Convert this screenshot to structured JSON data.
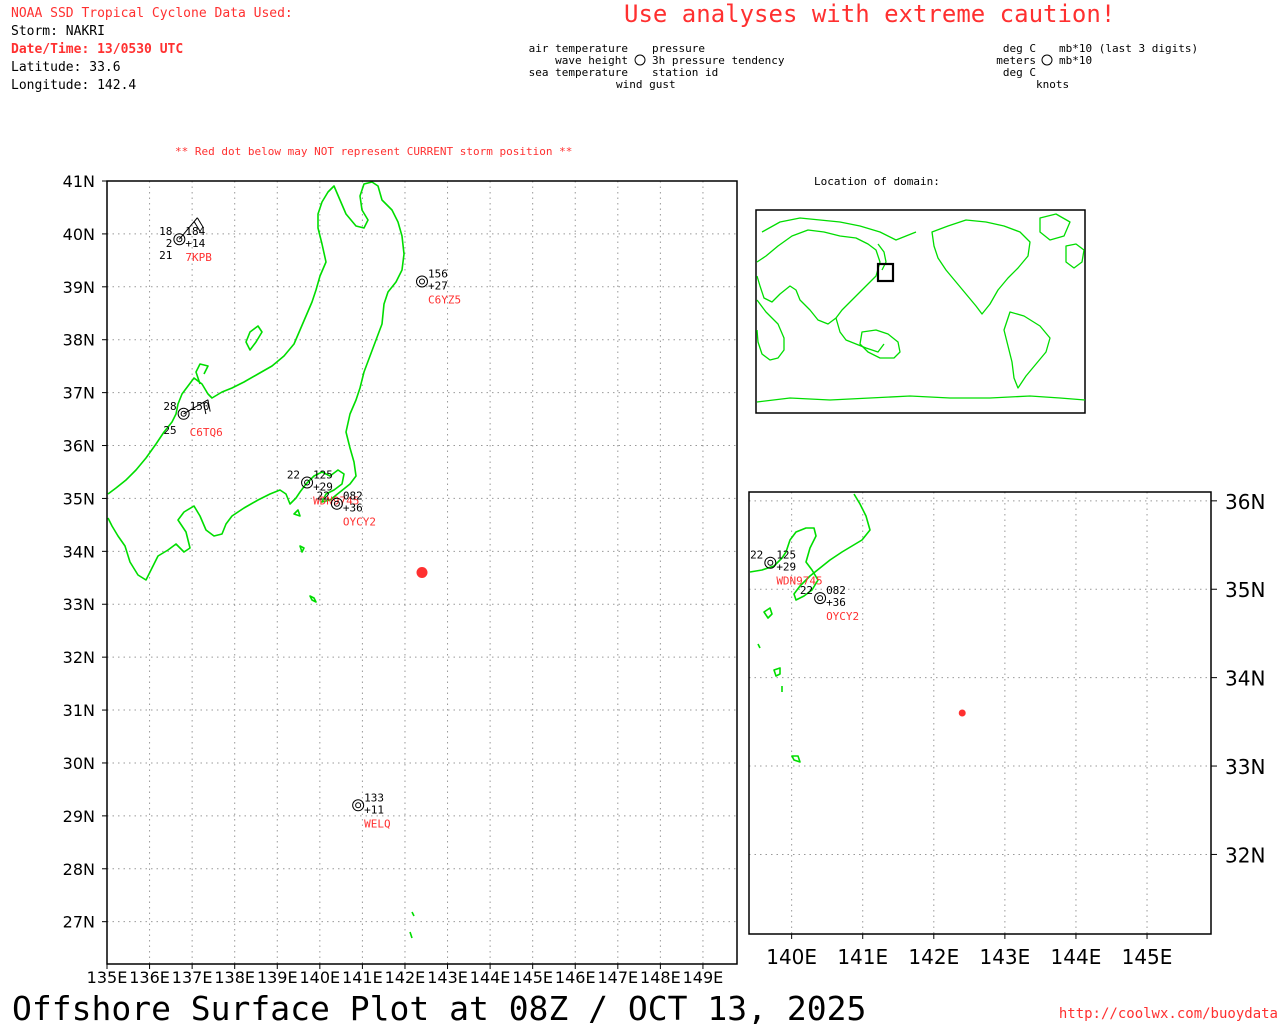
{
  "header": {
    "source_title": "NOAA SSD Tropical Cyclone Data Used:",
    "storm": "Storm: NAKRI",
    "datetime": "Date/Time: 13/0530 UTC",
    "latitude": "Latitude: 33.6",
    "longitude": "Longitude: 142.4",
    "caution": "Use analyses with extreme caution!",
    "red_dot_note": "** Red dot below may NOT represent CURRENT storm position **",
    "domain_title": "Location of domain:",
    "footer_title": "Offshore Surface Plot at 08Z / OCT 13, 2025",
    "footer_url": "http://coolwx.com/buoydata"
  },
  "legend": {
    "left": [
      "air temperature",
      "wave height",
      "sea temperature"
    ],
    "right": [
      "pressure",
      "3h pressure tendency",
      "station id"
    ],
    "bottom": "wind gust",
    "units_left": [
      "deg C",
      "meters",
      "deg C"
    ],
    "units_right": [
      "mb*10 (last 3 digits)",
      "mb*10"
    ],
    "units_bottom": "knots"
  },
  "main_map": {
    "lon_range": [
      135,
      149.8
    ],
    "lat_range": [
      26.2,
      41
    ],
    "lat_labels": [
      "41N",
      "40N",
      "39N",
      "38N",
      "37N",
      "36N",
      "35N",
      "34N",
      "33N",
      "32N",
      "31N",
      "30N",
      "29N",
      "28N",
      "27N"
    ],
    "lon_labels": [
      "135E",
      "136E",
      "137E",
      "138E",
      "139E",
      "140E",
      "141E",
      "142E",
      "143E",
      "144E",
      "145E",
      "146E",
      "147E",
      "148E",
      "149E"
    ]
  },
  "inset_map": {
    "lon_range": [
      139.4,
      145.9
    ],
    "lat_range": [
      31.1,
      36.1
    ],
    "lat_labels": [
      "36N",
      "35N",
      "34N",
      "33N",
      "32N"
    ],
    "lon_labels": [
      "140E",
      "141E",
      "142E",
      "143E",
      "144E",
      "145E"
    ]
  },
  "storm_position": {
    "lon": 142.4,
    "lat": 33.6
  },
  "stations": [
    {
      "id": "7KPB",
      "lon": 136.7,
      "lat": 39.9,
      "air_temp": "18",
      "wave": "2",
      "sea_temp": "21",
      "pressure": "184",
      "tendency": "+14"
    },
    {
      "id": "C6YZ5",
      "lon": 142.4,
      "lat": 39.1,
      "pressure": "156",
      "tendency": "+27"
    },
    {
      "id": "C6TQ6",
      "lon": 136.8,
      "lat": 36.6,
      "air_temp": "28",
      "sea_temp": "25",
      "pressure": "150"
    },
    {
      "id": "WDN9745",
      "lon": 139.7,
      "lat": 35.3,
      "air_temp": "22",
      "pressure": "125",
      "tendency": "+29"
    },
    {
      "id": "OYCY2",
      "lon": 140.4,
      "lat": 34.9,
      "air_temp": "22",
      "pressure": "082",
      "tendency": "+36"
    },
    {
      "id": "WELQ",
      "lon": 140.9,
      "lat": 29.2,
      "pressure": "133",
      "tendency": "+11"
    }
  ],
  "colors": {
    "coast": "#00dd00",
    "station_id": "#ff3030",
    "storm": "#ff3030"
  }
}
